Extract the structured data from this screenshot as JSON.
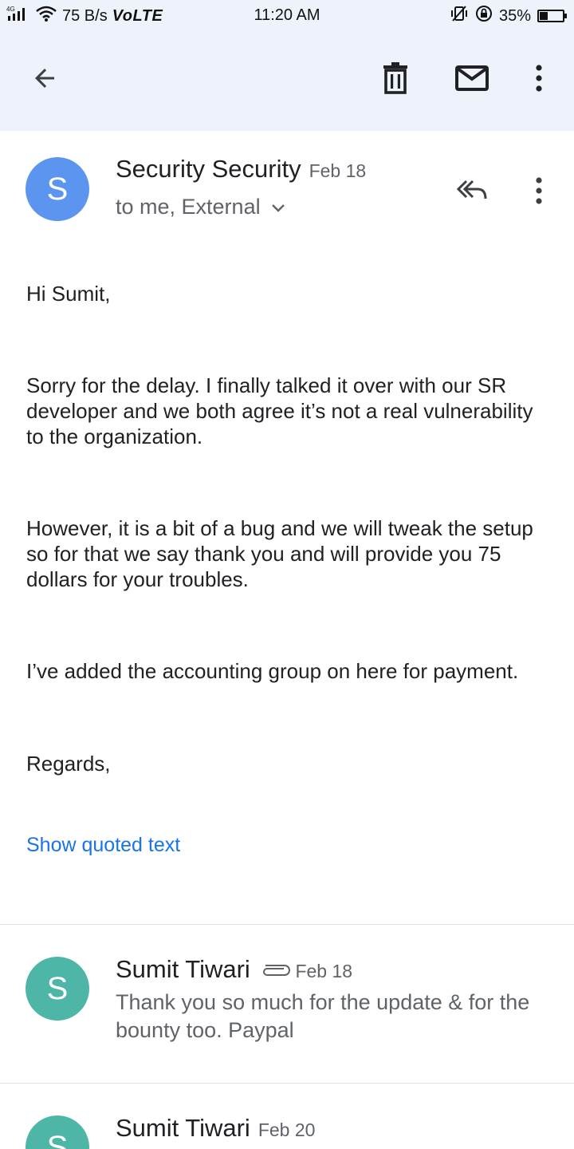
{
  "status_bar": {
    "network_type": "4G",
    "speed": "75 B/s",
    "volte": "VoLTE",
    "time": "11:20 AM",
    "battery": "35%",
    "battery_level": 0.35
  },
  "app_bar": {
    "icons": [
      "back-arrow-icon",
      "delete-icon",
      "mark-unread-icon",
      "more-vert-icon"
    ]
  },
  "message": {
    "avatar_letter": "S",
    "avatar_color": "#5b95f0",
    "sender": "Security Security",
    "date": "Feb 18",
    "recipients": "to me, External",
    "greeting": "Hi Sumit,",
    "para1": "Sorry for the delay. I finally talked it over with our SR developer and we both agree it’s not a real vulnerability to the organization.",
    "para2": "However, it is a bit of a bug and we will tweak the setup so for that we say thank you and will provide you 75 dollars for your troubles.",
    "para3": "I’ve added the accounting group on here for payment.",
    "signoff": "Regards,",
    "show_quoted": "Show quoted text"
  },
  "thread": [
    {
      "avatar_letter": "S",
      "avatar_color": "#4db6a6",
      "sender": "Sumit Tiwari",
      "has_attachment": true,
      "date": "Feb 18",
      "snippet": "Thank you so much for the update & for the bounty too. Paypal"
    },
    {
      "avatar_letter": "S",
      "avatar_color": "#4db6a6",
      "sender": "Sumit Tiwari",
      "has_attachment": false,
      "date": "Feb 20",
      "snippet": ""
    }
  ]
}
